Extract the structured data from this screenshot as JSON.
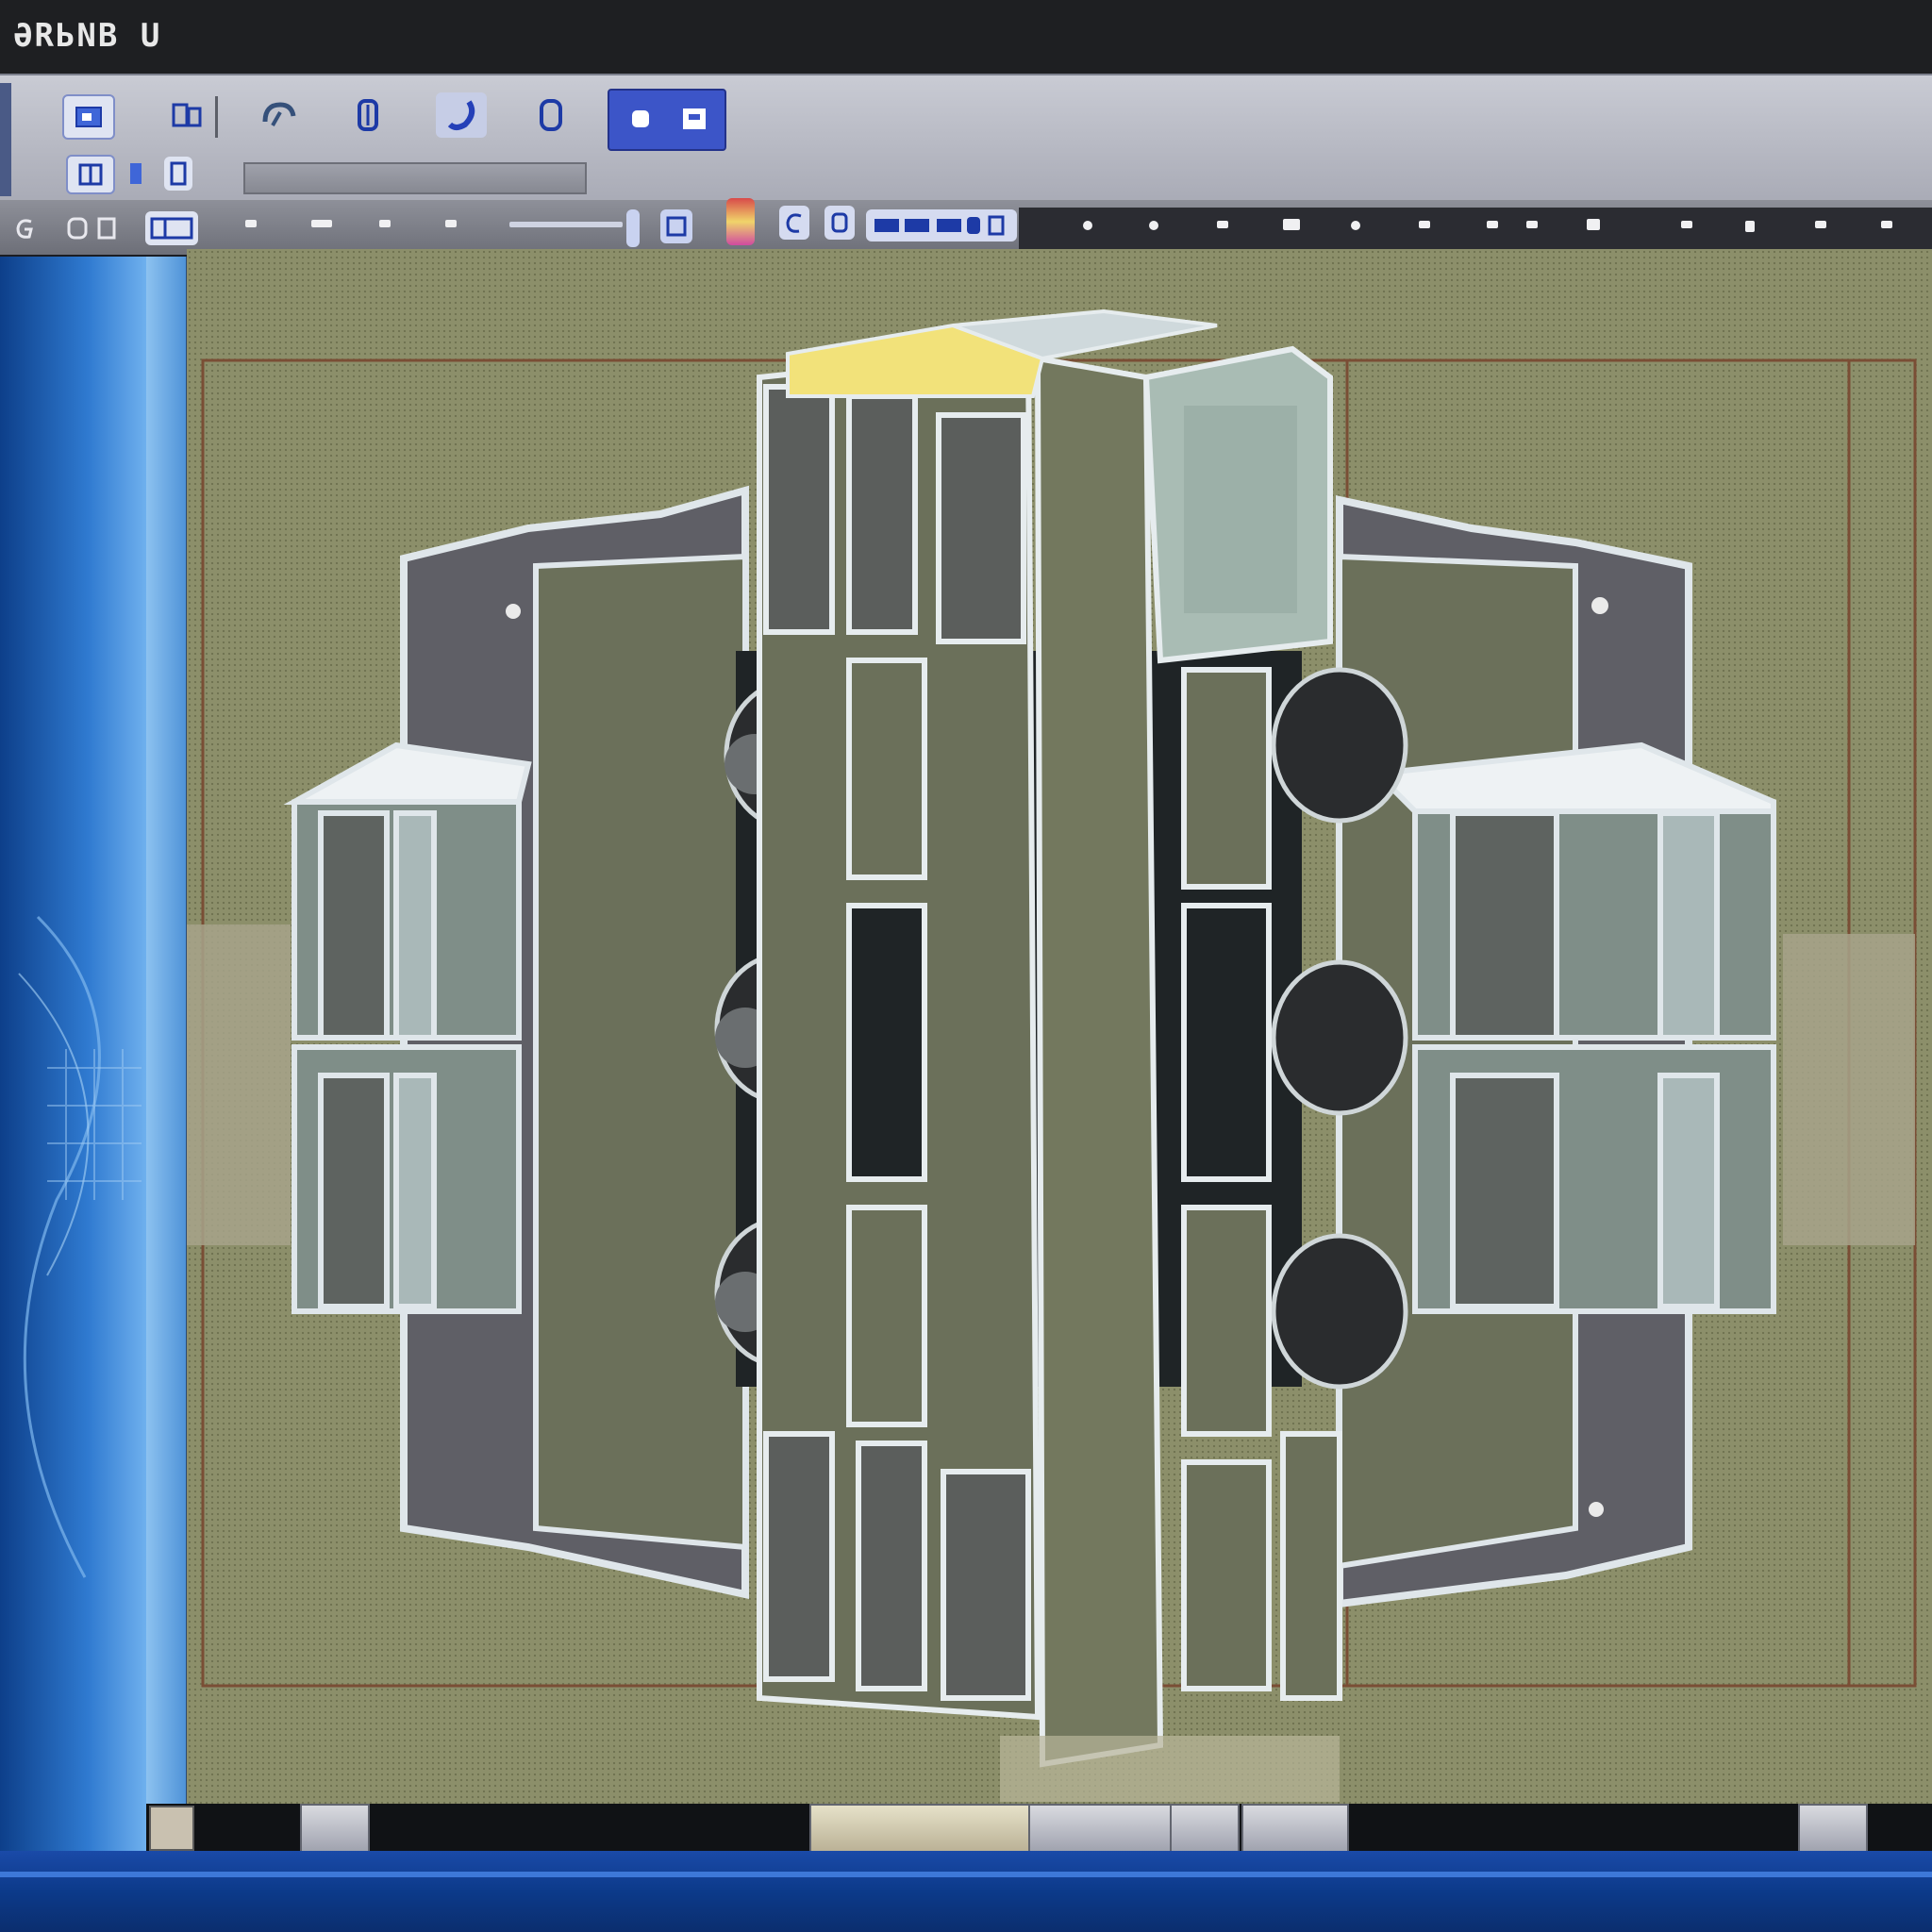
{
  "window": {
    "title": "ƏRЬNB U"
  },
  "toolbar": {
    "row1": [
      {
        "name": "new-icon"
      },
      {
        "name": "layers-icon"
      },
      {
        "name": "rotate-icon"
      },
      {
        "name": "pen-icon"
      },
      {
        "name": "paint-icon"
      },
      {
        "name": "document-icon"
      },
      {
        "name": "view-icon"
      },
      {
        "name": "save-icon"
      }
    ],
    "row2": [
      {
        "name": "grid-icon"
      },
      {
        "name": "snap-icon"
      },
      {
        "name": "measure-icon"
      }
    ],
    "path_field": ""
  },
  "colors": {
    "canvas": "#8c8f6a",
    "accent": "#1d3aa6",
    "panel": "#2f7ad0"
  }
}
